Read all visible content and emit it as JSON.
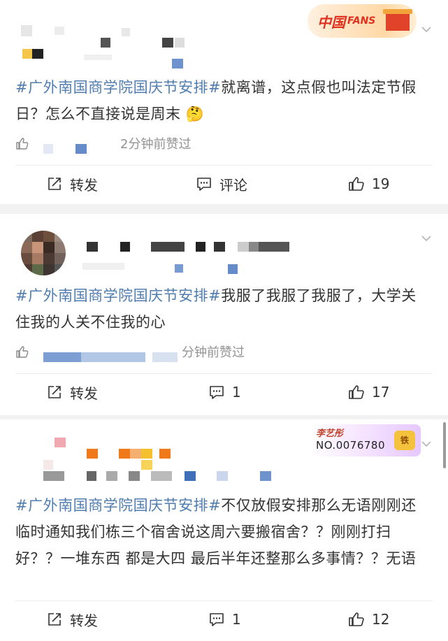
{
  "posts": [
    {
      "hashtag": "#广外南国商学院国庆节安排#",
      "text": "就离谱，这点假也叫法定节假日？怎么不直接说是周末",
      "emoji": "🤔",
      "time": "2分钟前赞过",
      "actions": {
        "repost": "转发",
        "comment": "评论",
        "likes": "19"
      },
      "badge": {
        "line1": "中国",
        "line2": "FANS"
      }
    },
    {
      "hashtag": "#广外南国商学院国庆节安排#",
      "text": "我服了我服了我服了，大学关住我的人关不住我的心",
      "time": "分钟前赞过",
      "actions": {
        "repost": "转发",
        "comment": "1",
        "likes": "17"
      }
    },
    {
      "hashtag": "#广外南国商学院国庆节安排#",
      "text": "不仅放假安排那么无语刚刚还临时通知我们栋三个宿舍说这周六要搬宿舍？？刚刚打扫好？？一堆东西 都是大四 最后半年还整那么多事情？？无语",
      "actions": {
        "repost": "转发",
        "comment": "1",
        "likes": "12"
      },
      "badge": {
        "name": "李艺彤",
        "number": "NO.0076780",
        "icon": "铁"
      }
    }
  ],
  "colors": {
    "hashtag": "#507daf",
    "time": "#939393",
    "background": "#f2f2f2"
  },
  "icons": [
    "like-icon",
    "repost-icon",
    "comment-icon",
    "chevron-down-icon"
  ]
}
